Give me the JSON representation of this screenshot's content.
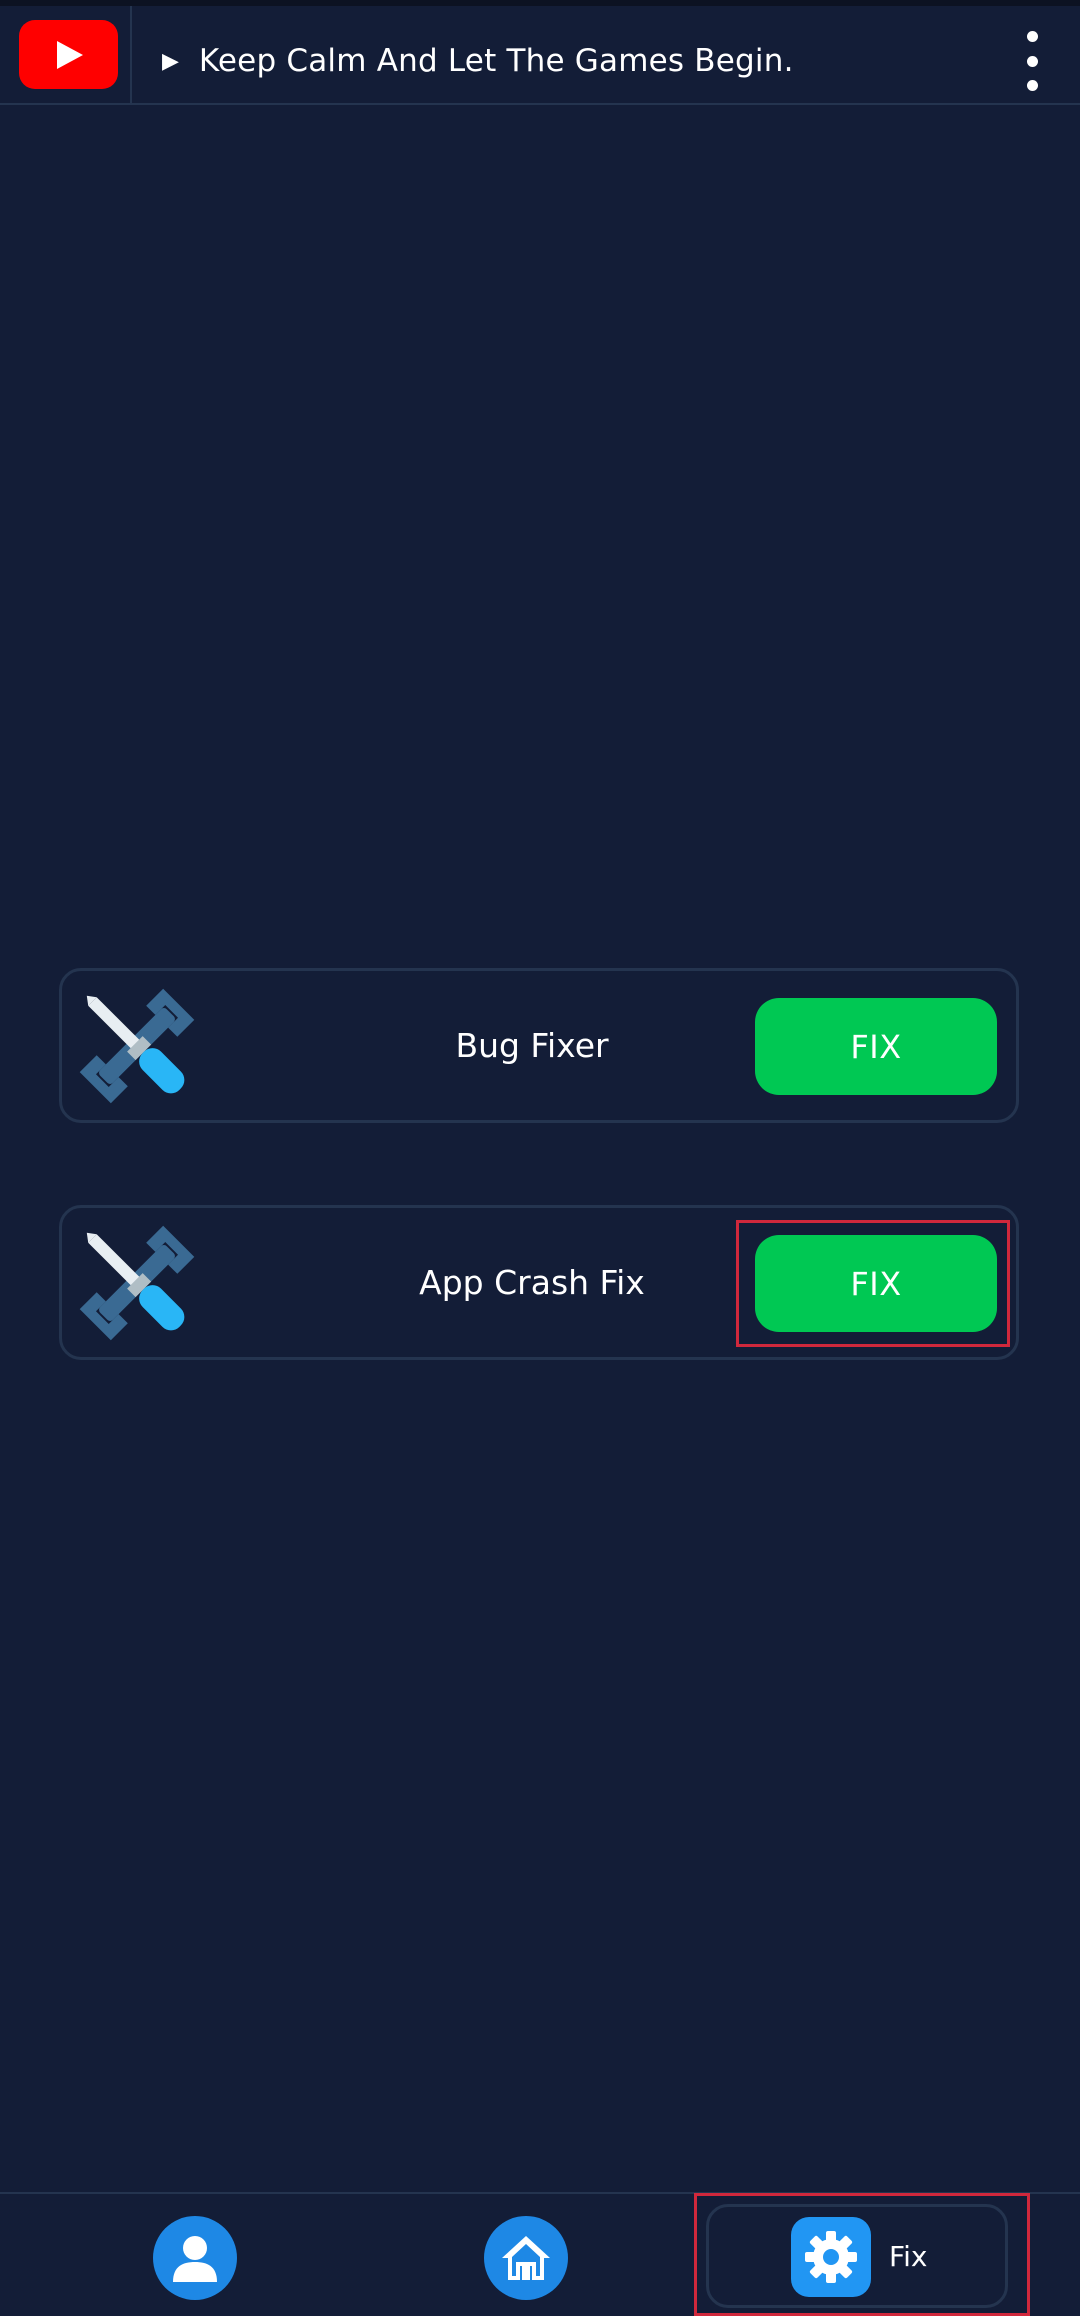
{
  "header": {
    "ticker_arrow": "▶",
    "ticker_text": "Keep Calm And Let The Games Begin."
  },
  "cards": [
    {
      "label": "Bug Fixer",
      "button": "FIX"
    },
    {
      "label": "App Crash Fix",
      "button": "FIX"
    }
  ],
  "bottom_nav": {
    "items": [
      {
        "icon": "user-icon"
      },
      {
        "icon": "home-icon"
      },
      {
        "icon": "gear-icon",
        "label": "Fix"
      }
    ]
  },
  "colors": {
    "background": "#131d37",
    "accent_green": "#00c853",
    "accent_blue": "#1e88e5",
    "youtube_red": "#ff0000",
    "highlight_red": "#d0283c"
  }
}
